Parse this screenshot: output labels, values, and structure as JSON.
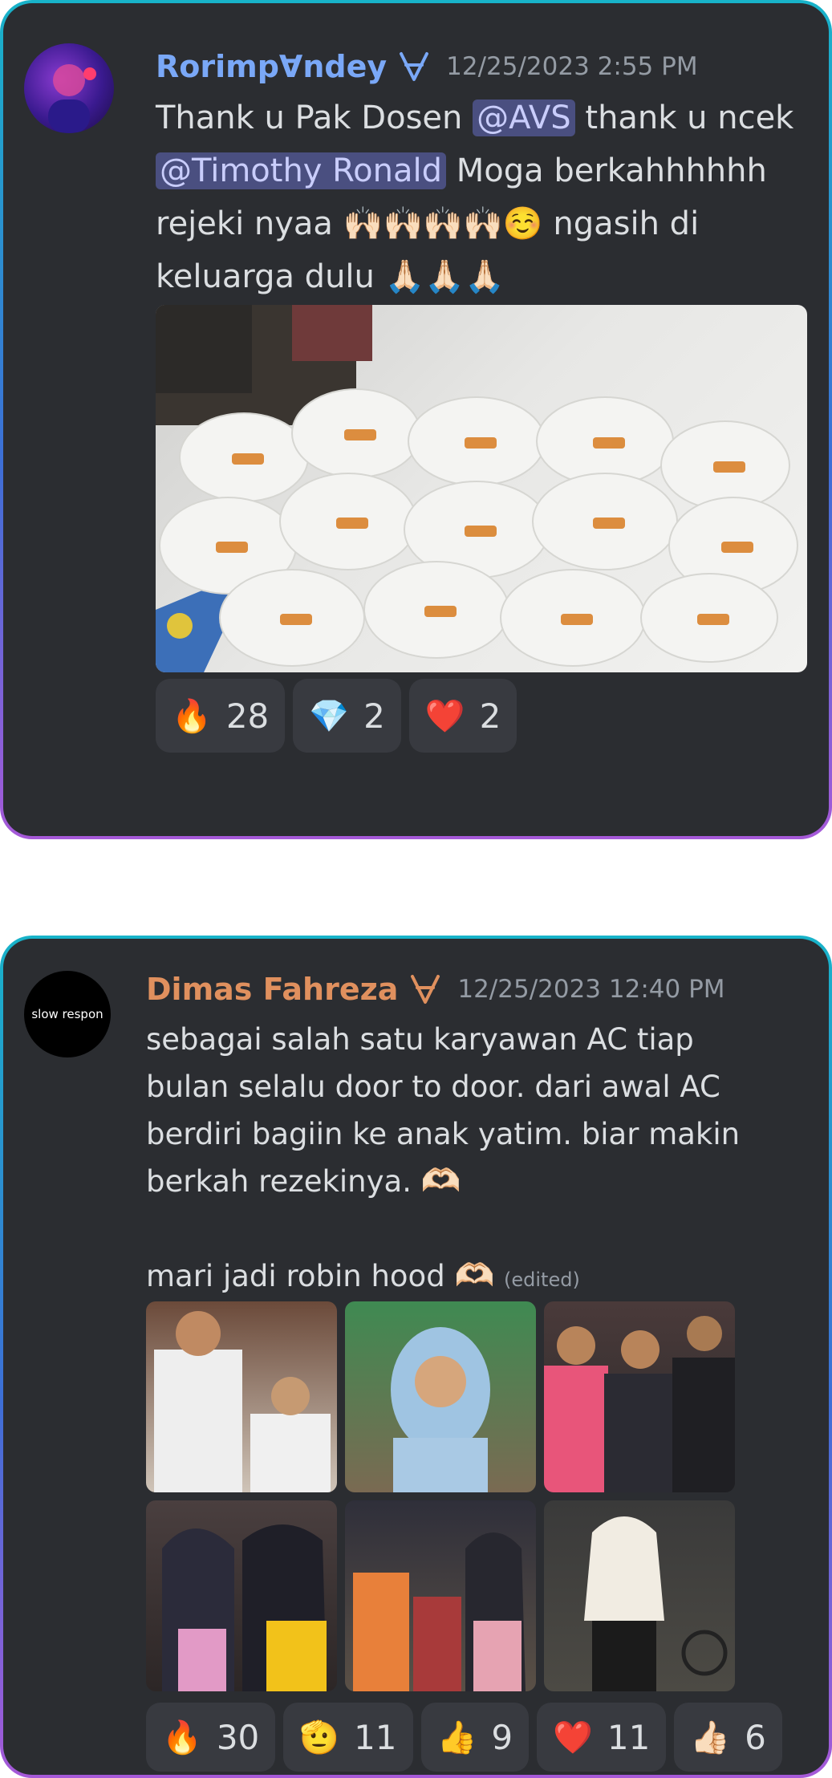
{
  "messages": [
    {
      "username": "Rorimp∀ndey",
      "timestamp": "12/25/2023 2:55 PM",
      "name_color": "#7aa8f7",
      "text_part1": "Thank u Pak Dosen ",
      "mention1": "@AVS",
      "text_part2": " thank u ncek",
      "mention2": "@Timothy Ronald",
      "text_part3": " Moga berkahhhhhh rejeki nyaa ",
      "emoji1": "🙌🏻🙌🏻🙌🏻🙌🏻☺️",
      "text_part4": " ngasih di keluarga dulu ",
      "emoji2": "🙏🏻🙏🏻🙏🏻",
      "reactions": [
        {
          "emoji": "🔥",
          "count": "28"
        },
        {
          "emoji": "💎",
          "count": "2"
        },
        {
          "emoji": "❤️",
          "count": "2"
        }
      ]
    },
    {
      "username": "Dimas Fahreza",
      "timestamp": "12/25/2023 12:40 PM",
      "name_color": "#e0905e",
      "avatar_text": "slow respon",
      "text_line1": "sebagai salah satu karyawan AC tiap bulan selalu door to door. dari awal AC berdiri bagiin ke anak yatim. biar makin berkah rezekinya. ",
      "emoji1": "🫶🏻",
      "text_line2": "mari jadi robin hood ",
      "emoji2": "🫶🏻",
      "edited": "(edited)",
      "reactions": [
        {
          "emoji": "🔥",
          "count": "30"
        },
        {
          "emoji": "🫡",
          "count": "11"
        },
        {
          "emoji": "👍",
          "count": "9"
        },
        {
          "emoji": "❤️",
          "count": "11"
        },
        {
          "emoji": "👍🏻",
          "count": "6"
        }
      ]
    }
  ]
}
